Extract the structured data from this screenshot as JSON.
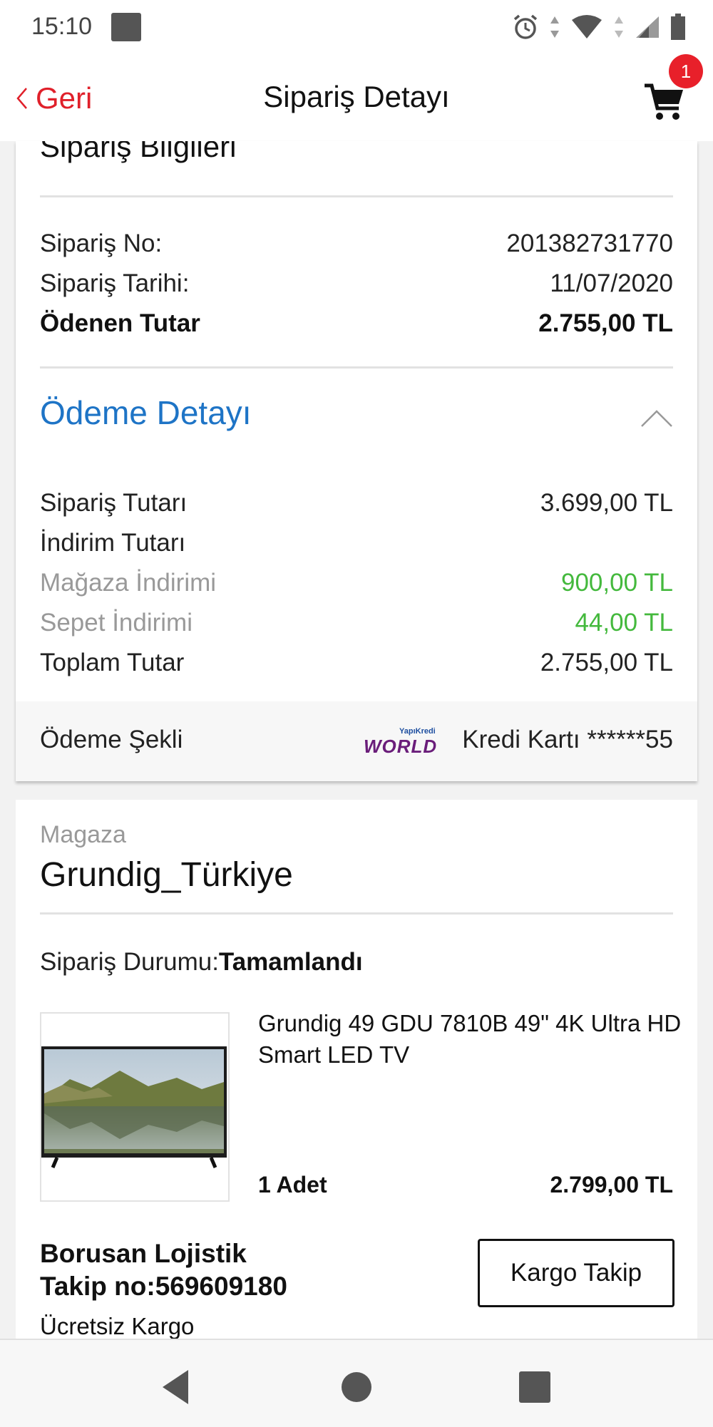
{
  "status_bar": {
    "time": "15:10",
    "icons": [
      "notification-square-icon",
      "alarm-icon",
      "data-arrows-icon",
      "wifi-icon",
      "signal-icon",
      "battery-icon"
    ]
  },
  "header": {
    "back_label": "Geri",
    "title": "Sipariş Detayı",
    "cart_badge": "1",
    "accent_color": "#e0202a"
  },
  "order_info": {
    "section_title": "Sipariş Bilgileri",
    "rows": [
      {
        "label": "Sipariş No:",
        "value": "201382731770"
      },
      {
        "label": "Sipariş Tarihi:",
        "value": "11/07/2020"
      },
      {
        "label": "Ödenen Tutar",
        "value": "2.755,00 TL"
      }
    ]
  },
  "payment_detail": {
    "title": "Ödeme Detayı",
    "title_color": "#1e74c6",
    "rows": [
      {
        "label": "Sipariş Tutarı",
        "value": "3.699,00 TL"
      },
      {
        "label": "İndirim Tutarı",
        "value": ""
      },
      {
        "label": "Mağaza İndirimi",
        "value": "900,00 TL"
      },
      {
        "label": "Sepet İndirimi",
        "value": "44,00 TL"
      },
      {
        "label": "Toplam Tutar",
        "value": "2.755,00 TL"
      }
    ],
    "discount_color": "#44b93d"
  },
  "payment_method": {
    "label": "Ödeme Şekli",
    "logo_top": "YapıKredi",
    "logo_main": "WORLD",
    "card": "Kredi Kartı ******55"
  },
  "store": {
    "label": "Magaza",
    "name": "Grundig_Türkiye",
    "status_label": "Sipariş Durumu:",
    "status_value": "Tamamlandı",
    "product": {
      "name": "Grundig 49 GDU 7810B 49\" 4K Ultra HD Smart LED TV",
      "quantity": "1 Adet",
      "price": "2.799,00 TL"
    },
    "shipping": {
      "carrier": "Borusan Lojistik",
      "tracking": "Takip no:569609180",
      "note": "Ücretsiz Kargo",
      "button_label": "Kargo Takip"
    }
  },
  "nav_bar": {
    "buttons": [
      "back-triangle-icon",
      "home-circle-icon",
      "recents-square-icon"
    ]
  }
}
